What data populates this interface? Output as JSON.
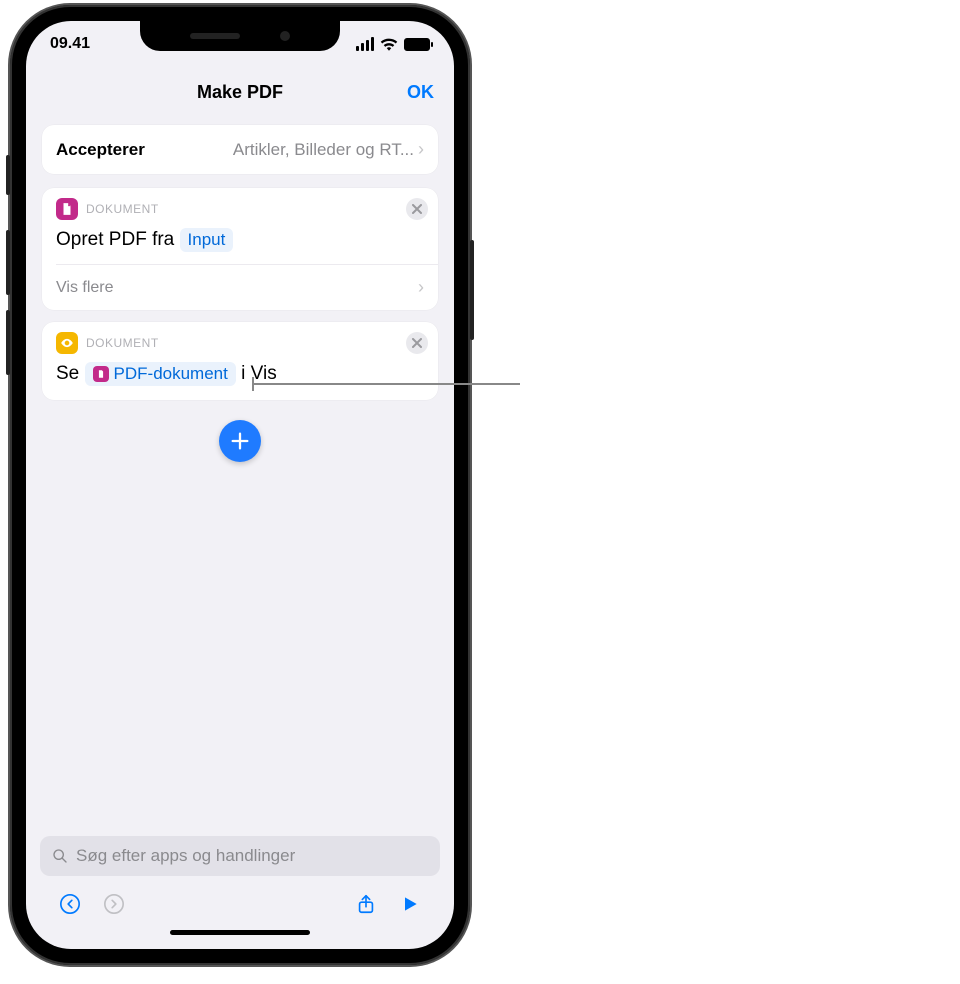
{
  "status": {
    "time": "09.41"
  },
  "nav": {
    "title": "Make PDF",
    "ok": "OK"
  },
  "accept": {
    "label": "Accepterer",
    "value": "Artikler, Billeder og RT..."
  },
  "action1": {
    "category": "DOKUMENT",
    "prefix": "Opret PDF fra",
    "token": "Input",
    "show_more": "Vis flere"
  },
  "action2": {
    "category": "DOKUMENT",
    "prefix": "Se",
    "token": "PDF-dokument",
    "suffix": "i Vis"
  },
  "search": {
    "placeholder": "Søg efter apps og handlinger"
  }
}
